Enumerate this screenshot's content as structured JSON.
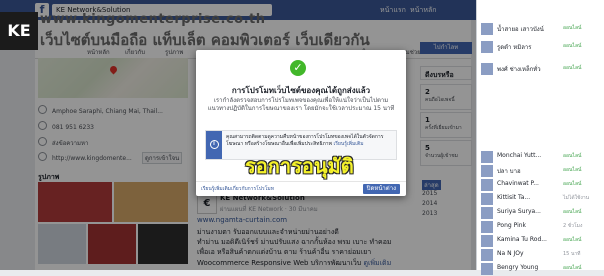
{
  "topbar": {
    "logo": "f",
    "search_value": "KE Network&Solution",
    "nav": [
      "หน้าแรก",
      "หน้าหลัก"
    ]
  },
  "overlay_badge": "KE",
  "cover": {
    "url": "www.kingomenterprise.co.th",
    "title": "เว็บไซต์บนมือถือ แท็บเล็ต คอมพิวเตอร์ เว็บเดียวกัน"
  },
  "pagenav": {
    "left": [
      "หน้าหลัก",
      "เกี่ยวกับ",
      "รูปภาพ"
    ],
    "right": [
      "การถูกใจ",
      "ความช่วยเหลือ"
    ]
  },
  "about": {
    "address": "Amphoe Saraphi, Chiang Mai, Thail...",
    "phone": "081 951 6233",
    "message": "ส่งข้อความหา",
    "website": "http://www.kingdomente...",
    "hours_button": "ดูการเข้าใจน"
  },
  "photos_heading": "รูปภาพ",
  "post": {
    "page_name": "KE Network&Solution",
    "meta": "ผ่านแผนที่ KE Network · 30 มีนาคม",
    "url": "www.ngamta-curtain.com",
    "lines": [
      "ม่านงามตา รับออกแบบและจำหน่ายม่านอย่างดี",
      "ทำม่าน มอดิดีเนิร์ชร์ ม่านปรับแสง ฉากกั้นห้อง พรม เบาะ ทำคอม",
      "เพื่อเอ หรือสินค้าตกแต่งบ้าน ตาม ร้านค้าอื่น ราคาย่อมเยา"
    ],
    "footer_text": "Woocommerce Responsive Web บริการพัฒนาเว็บ",
    "footer_link": "ดูเพิ่มเติม"
  },
  "years": [
    "ล่าสุด",
    "2015",
    "2014",
    "2013"
  ],
  "right_panel": {
    "button": "ไปกำไลท",
    "box_title": "ดีงบรหรือ",
    "stat1_num": "2",
    "stat1_lbl": "คนถือไอเพจนี้",
    "stat2_num": "1",
    "stat2_lbl": "ครั้งที่เยี่ยมเข้ามา",
    "stat3_num": "5",
    "stat3_lbl": "จำนวนผู้เข้าชม"
  },
  "chat": [
    {
      "name": "น้ำสายอ เสาวบังน์",
      "status": "ออนไลน์"
    },
    {
      "name": "รูดดำ หมิลาร",
      "status": "ออนไลน์"
    },
    {
      "name": "พงศ์ ช่างเหล็กทั่ว",
      "status": "ออนไลน์"
    },
    {
      "name": "Monchai Yutt...",
      "status": "ออนไลน์"
    },
    {
      "name": "ปลา บาฮ",
      "status": "ออนไลน์"
    },
    {
      "name": "Chavinwat P...",
      "status": "ออนไลน์"
    },
    {
      "name": "Kittisit Ta...",
      "status": "ไม่ได้ใช้งาน",
      "away": true
    },
    {
      "name": "Suriya Surya...",
      "status": "ออนไลน์"
    },
    {
      "name": "Pong Pink",
      "status": "2 ชั่วโมง",
      "away": true
    },
    {
      "name": "Kamina Tu Rod...",
      "status": "ออนไลน์"
    },
    {
      "name": "Na N JOy",
      "status": "15 นาที",
      "away": true
    },
    {
      "name": "Bengry Young",
      "status": "ออนไลน์"
    }
  ],
  "dialog": {
    "title": "การโปรโมทเว็บไซต์ของคุณได้ถูกส่งแล้ว",
    "body": "เรากำลังตรวจสอบการโปรโมทเพจของคุณเพื่อให้แน่ใจว่าเป็นไปตามแนวทางปฏิบัติในการโฆษณาของเรา โดยมักจะใช้เวลาประมาณ 15 นาที",
    "info_text": "คุณสามารถติดตามดูความคืบหน้าของการโปรโมทของเพจได้ในตัวจัดการโฆษณา หรือสร้างโฆษณาอื่นเพื่อเพิ่มประสิทธิภาพ",
    "info_link": "เรียนรู้เพิ่มเติม",
    "learn_link": "เรียนรู้เพิ่มเติมเกี่ยวกับการโปรโมท",
    "close_button": "ปิดหน้าต่าง"
  },
  "stamp_text": "รอการอนุมัติ"
}
